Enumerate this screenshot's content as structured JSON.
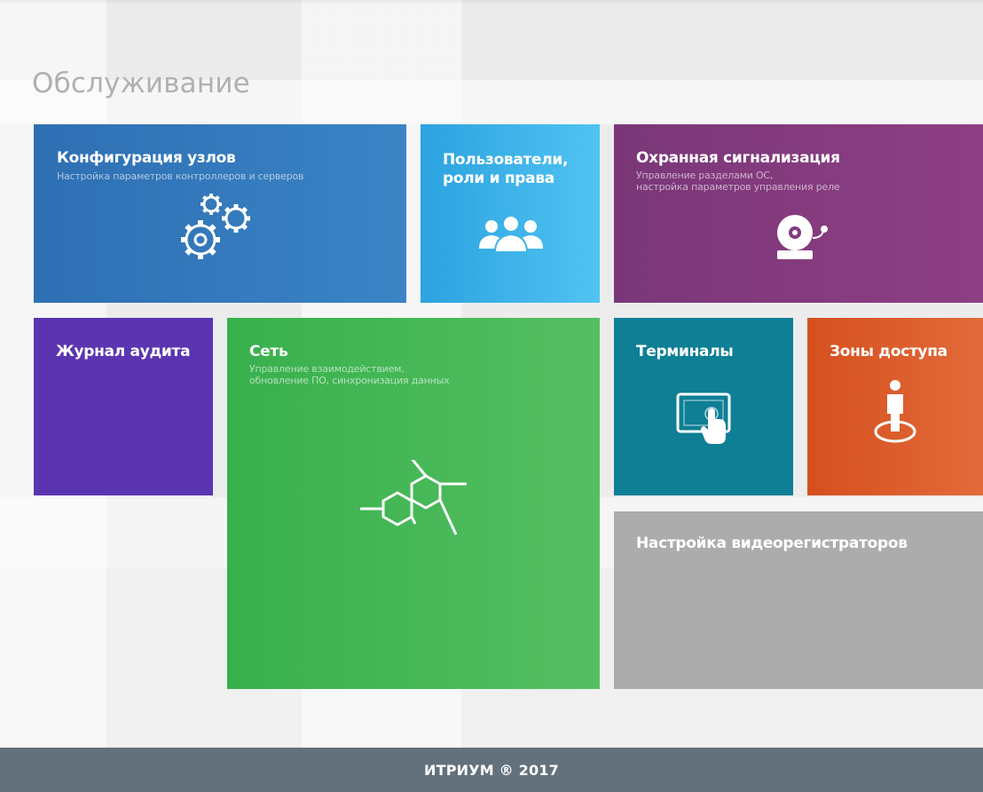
{
  "page": {
    "title": "Обслуживание",
    "footer": "ИТРИУМ ® 2017"
  },
  "tiles": {
    "config": {
      "title": "Конфигурация узлов",
      "subtitle": "Настройка параметров контроллеров и серверов",
      "icon": "gears-icon",
      "color": "#3478bd"
    },
    "users": {
      "title_line1": "Пользователи,",
      "title_line2": "роли и права",
      "icon": "users-icon",
      "color": "#3db4ea"
    },
    "alarm": {
      "title": "Охранная сигнализация",
      "subtitle_line1": "Управление разделами ОС,",
      "subtitle_line2": "настройка параметров управления реле",
      "icon": "alarm-bell-icon",
      "color": "#843b7f"
    },
    "audit": {
      "title": "Журнал аудита",
      "color": "#5b35b0"
    },
    "network": {
      "title": "Сеть",
      "subtitle_line1": "Управление взаимодействием,",
      "subtitle_line2": "обновление ПО, синхронизация данных",
      "icon": "network-molecule-icon",
      "color": "#45b757"
    },
    "terminals": {
      "title": "Терминалы",
      "icon": "touch-terminal-icon",
      "color": "#0e7f95"
    },
    "zones": {
      "title": "Зоны доступа",
      "icon": "person-zone-icon",
      "color": "#dc5d2c"
    },
    "video": {
      "title": "Настройка видеорегистраторов",
      "color": "#acacac"
    }
  }
}
